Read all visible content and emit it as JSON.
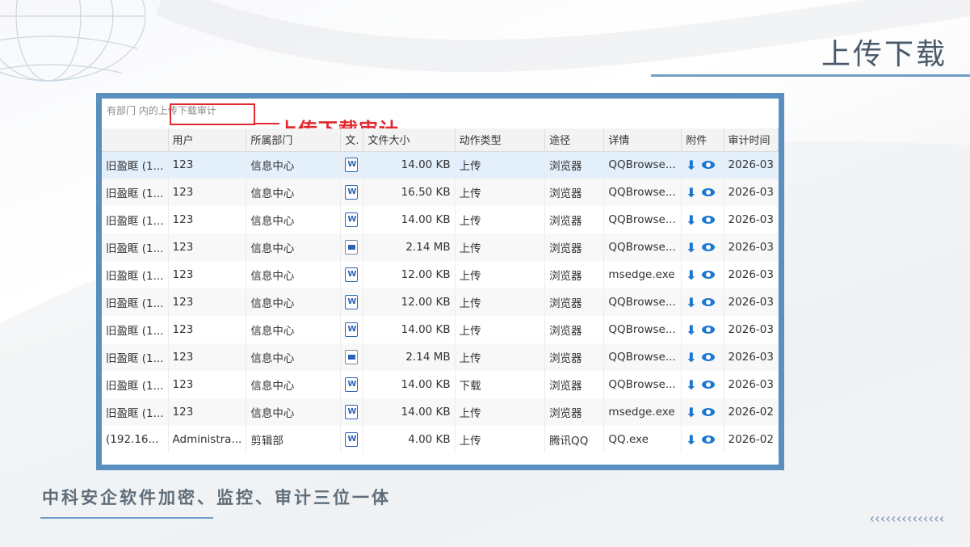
{
  "slide": {
    "title": "上传下载",
    "tagline": "中科安企软件加密、监控、审计三位一体",
    "chevrons": "‹‹‹‹‹‹‹‹‹‹‹‹‹‹"
  },
  "screen": {
    "crumb_prefix": "有部门 内的",
    "crumb_highlight": "上传下载审计",
    "annotation": "上传下载审计",
    "columns": [
      "",
      "用户",
      "所属部门",
      "文.",
      "文件大小",
      "动作类型",
      "途径",
      "详情",
      "附件",
      "审计时间"
    ],
    "rows": [
      {
        "name": "旧盈眶 (1...",
        "user": "123",
        "dept": "信息中心",
        "icon": "word-file-icon",
        "size": "14.00 KB",
        "action": "上传",
        "via": "浏览器",
        "detail": "QQBrowse...",
        "time": "2026-03"
      },
      {
        "name": "旧盈眶 (1...",
        "user": "123",
        "dept": "信息中心",
        "icon": "word-file-icon",
        "size": "16.50 KB",
        "action": "上传",
        "via": "浏览器",
        "detail": "QQBrowse...",
        "time": "2026-03"
      },
      {
        "name": "旧盈眶 (1...",
        "user": "123",
        "dept": "信息中心",
        "icon": "word-file-icon",
        "size": "14.00 KB",
        "action": "上传",
        "via": "浏览器",
        "detail": "QQBrowse...",
        "time": "2026-03"
      },
      {
        "name": "旧盈眶 (1...",
        "user": "123",
        "dept": "信息中心",
        "icon": "image-file-icon",
        "size": "2.14 MB",
        "action": "上传",
        "via": "浏览器",
        "detail": "QQBrowse...",
        "time": "2026-03"
      },
      {
        "name": "旧盈眶 (1...",
        "user": "123",
        "dept": "信息中心",
        "icon": "word-file-icon",
        "size": "12.00 KB",
        "action": "上传",
        "via": "浏览器",
        "detail": "msedge.exe",
        "time": "2026-03"
      },
      {
        "name": "旧盈眶 (1...",
        "user": "123",
        "dept": "信息中心",
        "icon": "word-file-icon",
        "size": "12.00 KB",
        "action": "上传",
        "via": "浏览器",
        "detail": "QQBrowse...",
        "time": "2026-03"
      },
      {
        "name": "旧盈眶 (1...",
        "user": "123",
        "dept": "信息中心",
        "icon": "word-file-icon",
        "size": "14.00 KB",
        "action": "上传",
        "via": "浏览器",
        "detail": "QQBrowse...",
        "time": "2026-03"
      },
      {
        "name": "旧盈眶 (1...",
        "user": "123",
        "dept": "信息中心",
        "icon": "image-file-icon",
        "size": "2.14 MB",
        "action": "上传",
        "via": "浏览器",
        "detail": "QQBrowse...",
        "time": "2026-03"
      },
      {
        "name": "旧盈眶 (1...",
        "user": "123",
        "dept": "信息中心",
        "icon": "word-file-icon",
        "size": "14.00 KB",
        "action": "下载",
        "via": "浏览器",
        "detail": "QQBrowse...",
        "time": "2026-03"
      },
      {
        "name": "旧盈眶 (1...",
        "user": "123",
        "dept": "信息中心",
        "icon": "word-file-icon",
        "size": "14.00 KB",
        "action": "上传",
        "via": "浏览器",
        "detail": "msedge.exe",
        "time": "2026-02"
      },
      {
        "name": "(192.16...",
        "user": "Administra...",
        "dept": "剪辑部",
        "icon": "word-file-icon",
        "size": "4.00 KB",
        "action": "上传",
        "via": "腾讯QQ",
        "detail": "QQ.exe",
        "time": "2026-02"
      }
    ],
    "selected_row": 0
  }
}
